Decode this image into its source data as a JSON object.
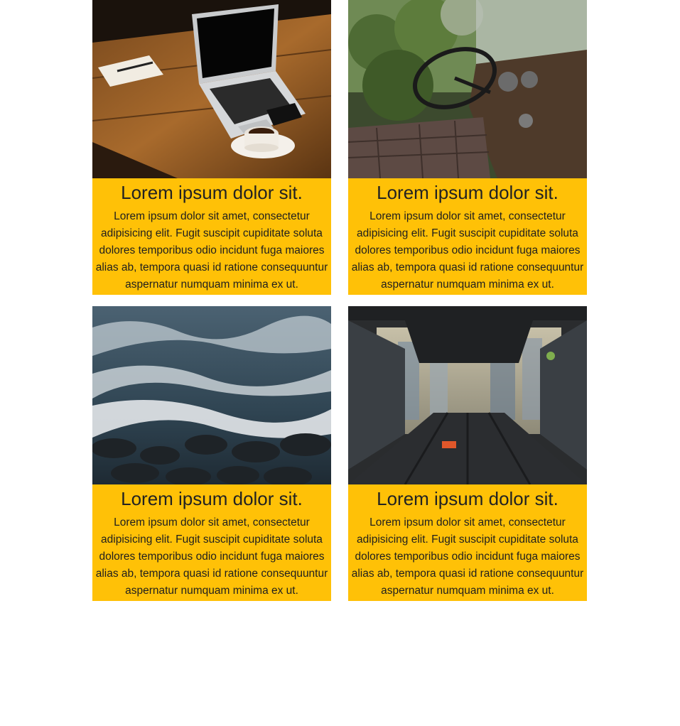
{
  "cards": [
    {
      "image": "laptop-coffee-photo",
      "title": "Lorem ipsum dolor sit.",
      "text": "Lorem ipsum dolor sit amet, consectetur adipisicing elit. Fugit suscipit cupiditate soluta dolores temporibus odio incidunt fuga maiores alias ab, tempora quasi id ratione consequuntur aspernatur numquam minima ex ut."
    },
    {
      "image": "abandoned-truck-interior-photo",
      "title": "Lorem ipsum dolor sit.",
      "text": "Lorem ipsum dolor sit amet, consectetur adipisicing elit. Fugit suscipit cupiditate soluta dolores temporibus odio incidunt fuga maiores alias ab, tempora quasi id ratione consequuntur aspernatur numquam minima ex ut."
    },
    {
      "image": "ocean-waves-rocks-photo",
      "title": "Lorem ipsum dolor sit.",
      "text": "Lorem ipsum dolor sit amet, consectetur adipisicing elit. Fugit suscipit cupiditate soluta dolores temporibus odio incidunt fuga maiores alias ab, tempora quasi id ratione consequuntur aspernatur numquam minima ex ut."
    },
    {
      "image": "truck-bed-city-view-photo",
      "title": "Lorem ipsum dolor sit.",
      "text": "Lorem ipsum dolor sit amet, consectetur adipisicing elit. Fugit suscipit cupiditate soluta dolores temporibus odio incidunt fuga maiores alias ab, tempora quasi id ratione consequuntur aspernatur numquam minima ex ut."
    }
  ],
  "colors": {
    "card_background": "#FFC107",
    "page_background": "#FFFFFF"
  }
}
